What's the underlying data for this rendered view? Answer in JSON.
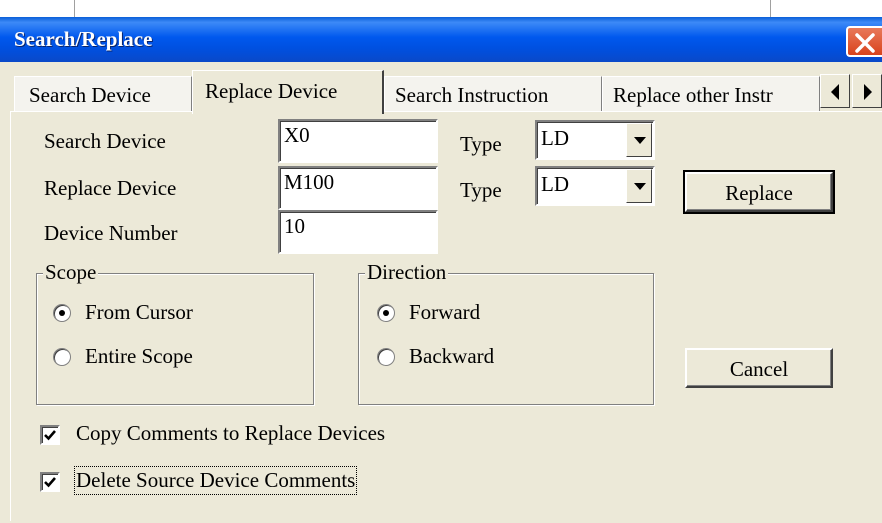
{
  "window": {
    "title": "Search/Replace"
  },
  "tabs": [
    {
      "label": "Search Device",
      "active": false
    },
    {
      "label": "Replace Device",
      "active": true
    },
    {
      "label": "Search Instruction",
      "active": false
    },
    {
      "label": "Replace other Instr",
      "active": false
    }
  ],
  "tab_scroll": {
    "left_icon": "triangle-left",
    "right_icon": "triangle-right"
  },
  "fields": {
    "search_device": {
      "label": "Search Device",
      "value": "X0"
    },
    "replace_device": {
      "label": "Replace Device",
      "value": "M100"
    },
    "device_number": {
      "label": "Device Number",
      "value": "10"
    }
  },
  "type_selects": {
    "label": "Type",
    "search_type": "LD",
    "replace_type": "LD"
  },
  "scope": {
    "label": "Scope",
    "options": [
      "From Cursor",
      "Entire Scope"
    ],
    "selected": "From Cursor"
  },
  "direction": {
    "label": "Direction",
    "options": [
      "Forward",
      "Backward"
    ],
    "selected": "Forward"
  },
  "buttons": {
    "replace": "Replace",
    "cancel": "Cancel"
  },
  "checkboxes": {
    "copy_comments": {
      "label": "Copy Comments to Replace Devices",
      "checked": true
    },
    "delete_comments": {
      "label": "Delete Source Device Comments",
      "checked": true
    }
  },
  "colors": {
    "titlebar": "#0058ee",
    "dialog_bg": "#ece9d8",
    "close_button": "#d9431c"
  }
}
